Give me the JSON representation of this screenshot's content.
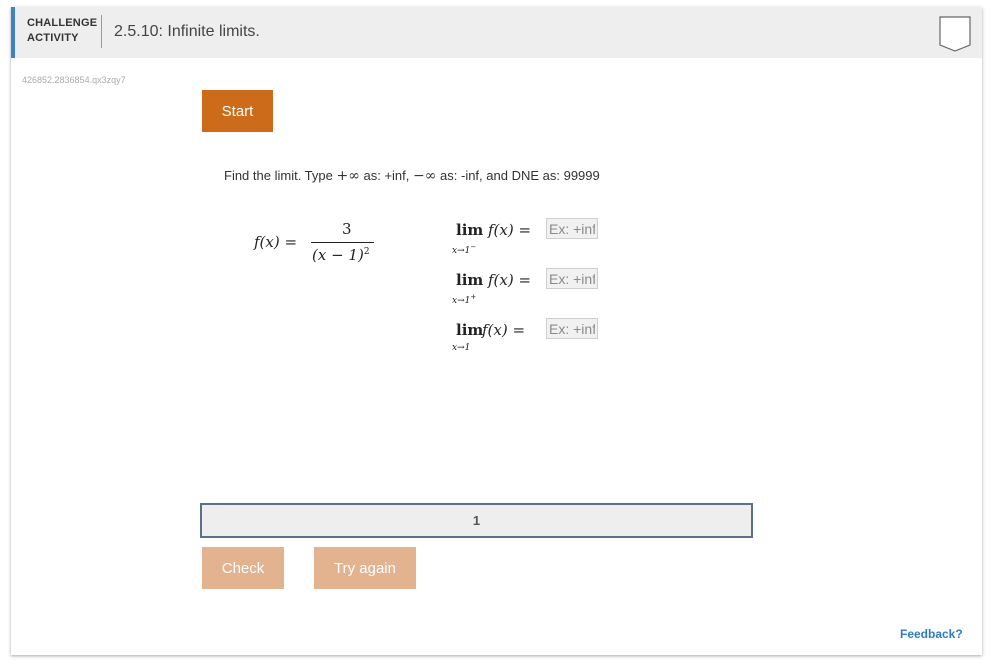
{
  "header": {
    "label_line1": "CHALLENGE",
    "label_line2": "ACTIVITY",
    "title": "2.5.10: Infinite limits.",
    "accent_color": "#3e82c4",
    "bookmark_icon": "bookmark-icon"
  },
  "activity_id": "426852.2836854.qx3zqy7",
  "start_button": {
    "label": "Start",
    "color": "#cc6c1b"
  },
  "instructions": {
    "part1": "Find the limit. Type ",
    "plus_inf": "+∞",
    "part2": " as: +inf, ",
    "minus_inf": "−∞",
    "part3": " as: -inf, and DNE as: 99999"
  },
  "function": {
    "lhs": "f(x) =",
    "numerator": "3",
    "denominator": "(x − 1)",
    "denominator_exp": "2"
  },
  "limits": [
    {
      "lim": "lim",
      "sub": "x→1",
      "sub_sup": "−",
      "expr": "f(x) =",
      "placeholder": "Ex: +inf",
      "value": ""
    },
    {
      "lim": "lim",
      "sub": "x→1",
      "sub_sup": "+",
      "expr": "f(x) =",
      "placeholder": "Ex: +inf",
      "value": ""
    },
    {
      "lim": "lim",
      "sub": "x→1",
      "sub_sup": "",
      "expr": "f(x) =",
      "placeholder": "Ex: +inf",
      "value": ""
    }
  ],
  "progress": {
    "level": "1",
    "border_color": "#5d6f8f"
  },
  "buttons": {
    "check": "Check",
    "try_again": "Try again",
    "disabled_color": "#e3b28e"
  },
  "feedback": "Feedback?"
}
